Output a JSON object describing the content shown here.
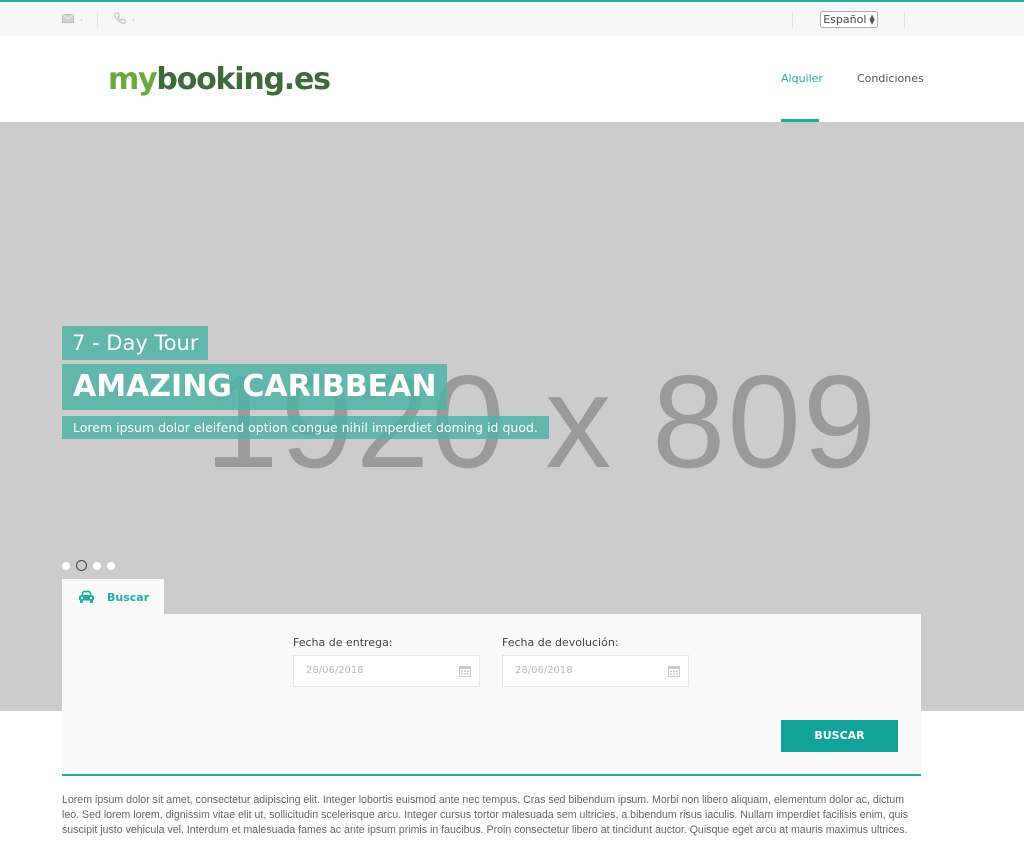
{
  "topbar": {
    "email": ".",
    "phone": ".",
    "language": "Español"
  },
  "header": {
    "logo_part1": "my",
    "logo_part2": "booking.es",
    "nav": [
      "Alquiler",
      "Condiciones"
    ]
  },
  "hero": {
    "placeholder": "1920 x 809",
    "caption_small": "7 - Day Tour",
    "caption_title": "AMAZING CARIBBEAN",
    "caption_text": "Lorem ipsum dolor eleifend option congue nihil imperdiet doming id quod.",
    "slide_count": 4,
    "active_slide": 2
  },
  "search": {
    "tab_label": "Buscar",
    "delivery_label": "Fecha de entrega:",
    "delivery_value": "28/06/2018",
    "return_label": "Fecha de devolución:",
    "return_value": "28/06/2018",
    "button": "BUSCAR"
  },
  "body_text": "Lorem ipsum dolor sit amet, consectetur adipiscing elit. Integer lobortis euismod ante nec tempus. Cras sed bibendum ipsum. Morbi non libero aliquam, elementum dolor ac, dictum leo. Sed lorem lorem, dignissim vitae elit ut, sollicitudin scelerisque arcu. Integer cursus tortor malesuada sem ultricies, a bibendum risus iaculis. Nullam imperdiet facilisis enim, quis suscipit justo vehicula vel. Interdum et malesuada fames ac ante ipsum primis in faucibus. Proin consectetur libero at tincidunt auctor. Quisque eget arcu at mauris maximus ultrices.",
  "colors": {
    "accent": "#1cb0a6",
    "button": "#11a39a",
    "hero_bg": "#cccccc",
    "logo_light": "#6aaa3a",
    "logo_dark": "#3d6b3a"
  }
}
